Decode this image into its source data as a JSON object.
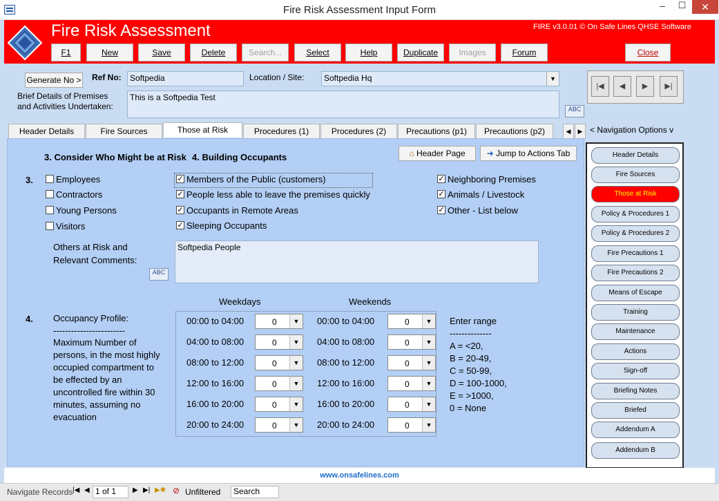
{
  "window": {
    "title": "Fire Risk Assessment Input Form",
    "minimize": "–",
    "maximize": "☐",
    "close": "✕"
  },
  "header": {
    "title": "Fire Risk Assessment",
    "version": "FIRE v3.0.01 © On Safe Lines QHSE Software",
    "buttons": {
      "f1": "F1",
      "new": "New",
      "save": "Save",
      "delete": "Delete",
      "search": "Search...",
      "select": "Select",
      "help": "Help",
      "duplicate": "Duplicate",
      "images": "Images",
      "forum": "Forum",
      "close": "Close"
    }
  },
  "form": {
    "generate_no": "Generate No >",
    "ref_no_label": "Ref No:",
    "ref_no_value": "Softpedia",
    "location_label": "Location / Site:",
    "location_value": "Softpedia Hq",
    "brief_label_1": "Brief Details of Premises",
    "brief_label_2": "and Activities Undertaken:",
    "brief_value": "This is a Softpedia Test",
    "spell_icon": "ABC"
  },
  "tabs": [
    "Header Details",
    "Fire Sources",
    "Those at Risk",
    "Procedures (1)",
    "Procedures (2)",
    "Precautions (p1)",
    "Precautions (p2)"
  ],
  "active_tab": "Those at Risk",
  "navigation_options_label": "< Navigation Options v",
  "panel": {
    "heading3": "3. Consider Who Might be at Risk",
    "heading4": "4. Building Occupants",
    "header_page_btn": "Header Page",
    "jump_actions_btn": "Jump to Actions Tab",
    "section3_num": "3.",
    "checkboxes": [
      {
        "label": "Employees",
        "checked": false
      },
      {
        "label": "Contractors",
        "checked": false
      },
      {
        "label": "Young Persons",
        "checked": false
      },
      {
        "label": "Visitors",
        "checked": false
      },
      {
        "label": "Members of the Public (customers)",
        "checked": true
      },
      {
        "label": "People less able to leave the premises quickly",
        "checked": true
      },
      {
        "label": "Occupants in Remote Areas",
        "checked": true
      },
      {
        "label": "Sleeping Occupants",
        "checked": true
      },
      {
        "label": "Neighboring Premises",
        "checked": true
      },
      {
        "label": "Animals / Livestock",
        "checked": true
      },
      {
        "label": "Other - List below",
        "checked": true
      }
    ],
    "others_label_1": "Others at Risk and",
    "others_label_2": "Relevant Comments:",
    "others_value": "Softpedia People",
    "section4_num": "4.",
    "occupancy_title": "Occupancy Profile:",
    "occupancy_sep": "------------------------",
    "occupancy_desc": [
      "Maximum Number of",
      "persons, in the most highly",
      "occupied compartment to",
      "be effected by an",
      "uncontrolled fire within 30",
      "minutes, assuming no",
      "evacuation"
    ],
    "weekdays_label": "Weekdays",
    "weekends_label": "Weekends",
    "times": [
      "00:00 to 04:00",
      "04:00 to 08:00",
      "08:00 to 12:00",
      "12:00 to 16:00",
      "16:00 to 20:00",
      "20:00 to 24:00"
    ],
    "weekday_values": [
      "0",
      "0",
      "0",
      "0",
      "0",
      "0"
    ],
    "weekend_values": [
      "0",
      "0",
      "0",
      "0",
      "0",
      "0"
    ],
    "range_title": "Enter range",
    "range_sep": "--------------",
    "ranges": [
      "A = <20,",
      "B = 20-49,",
      "C = 50-99,",
      "D = 100-1000,",
      "E = >1000,",
      "0 = None"
    ]
  },
  "nav_buttons": [
    "Header Details",
    "Fire Sources",
    "Those at Risk",
    "Policy & Procedures 1",
    "Policy & Procedures 2",
    "Fire Precautions 1",
    "Fire Precautions 2",
    "Means of Escape",
    "Training",
    "Maintenance",
    "Actions",
    "Sign-off",
    "Briefing Notes",
    "Briefed",
    "Addendum A",
    "Addendum B"
  ],
  "nav_active": "Those at Risk",
  "url": "www.onsafelines.com",
  "status": {
    "navigate_label": "Navigate Records",
    "record": "1 of 1",
    "filter": "Unfiltered",
    "search": "Search"
  }
}
